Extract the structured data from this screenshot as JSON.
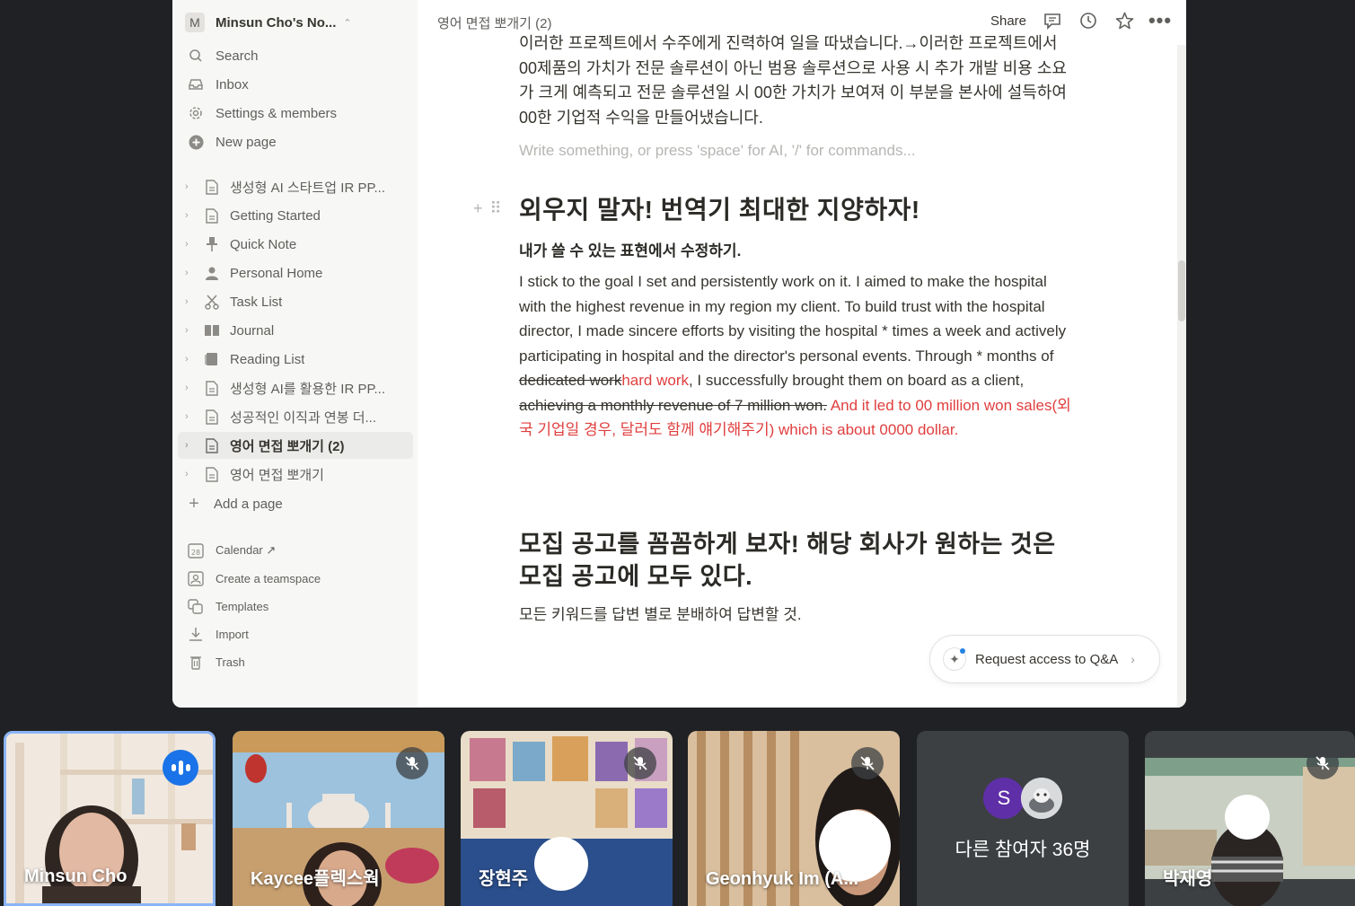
{
  "sidebar": {
    "workspace_initial": "M",
    "workspace_name": "Minsun Cho's No...",
    "nav": [
      {
        "label": "Search",
        "icon": "search-icon"
      },
      {
        "label": "Inbox",
        "icon": "inbox-icon"
      },
      {
        "label": "Settings & members",
        "icon": "gear-icon"
      },
      {
        "label": "New page",
        "icon": "plus-circle-icon"
      }
    ],
    "pages": [
      {
        "label": "생성형 AI 스타트업 IR PP...",
        "icon": "page-icon"
      },
      {
        "label": "Getting Started",
        "icon": "page-icon"
      },
      {
        "label": "Quick Note",
        "icon": "pin-icon"
      },
      {
        "label": "Personal Home",
        "icon": "person-icon"
      },
      {
        "label": "Task List",
        "icon": "scissors-icon"
      },
      {
        "label": "Journal",
        "icon": "book-icon"
      },
      {
        "label": "Reading List",
        "icon": "list-icon"
      },
      {
        "label": "생성형 AI를 활용한 IR PP...",
        "icon": "page-icon"
      },
      {
        "label": "성공적인 이직과 연봉 더...",
        "icon": "page-icon"
      },
      {
        "label": "영어 면접 뽀개기 (2)",
        "icon": "page-icon",
        "active": true
      },
      {
        "label": "영어 면접 뽀개기",
        "icon": "page-icon"
      }
    ],
    "add_page": "Add a page",
    "bottom": [
      {
        "label": "Calendar ↗",
        "icon": "calendar-icon"
      },
      {
        "label": "Create a teamspace",
        "icon": "teamspace-icon"
      },
      {
        "label": "Templates",
        "icon": "templates-icon"
      },
      {
        "label": "Import",
        "icon": "import-icon"
      },
      {
        "label": "Trash",
        "icon": "trash-icon"
      }
    ],
    "calendar_day": "28"
  },
  "topbar": {
    "breadcrumb": "영어 면접 뽀개기 (2)",
    "share": "Share"
  },
  "page": {
    "prev_paragraph": "이러한 프로젝트에서 수주에게 진력하여 일을 따냈습니다.→이러한 프로젝트에서 00제품의 가치가 전문 솔루션이 아닌 범용 솔루션으로 사용 시 추가 개발 비용 소요가 크게 예측되고 전문 솔루션일 시 00한 가치가 보여져 이 부분을 본사에 설득하여 00한 기업적 수익을 만들어냈습니다.",
    "placeholder": "Write something, or press 'space' for AI, '/' for commands...",
    "heading1": "외우지 말자! 번역기 최대한 지양하자!",
    "heading3": "내가 쓸 수 있는 표현에서 수정하기.",
    "para_a": "I stick to the goal I set and persistently work on it. I aimed to make the hospital with the highest revenue in my region my client. To build trust with the hospital director, I made sincere efforts by visiting the hospital * times a week and actively participating in hospital and the director's personal events. Through * months of ",
    "para_strike1": "dedicated work",
    "para_red1": "hard work",
    "para_b": ", I successfully brought them on board as a client, ",
    "para_strike2": "achieving a monthly revenue of 7 million won.",
    "para_red2": " And it led to 00 million won sales(외국 기업일 경우, 달러도 함께 얘기해주기) which is about 0000 dollar.",
    "heading2": "모집 공고를 꼼꼼하게 보자! 해당 회사가 원하는 것은 모집 공고에 모두 있다.",
    "para2": "모든 키워드를 답변 별로 분배하여 답변할 것.",
    "qa_button": "Request access to Q&A"
  },
  "meet": {
    "tiles": [
      {
        "name": "Minsun Cho",
        "state": "speaking"
      },
      {
        "name": "Kaycee플렉스웍",
        "state": "muted"
      },
      {
        "name": "장현주",
        "state": "muted"
      },
      {
        "name": "Geonhyuk Im (A...",
        "state": "muted"
      },
      {
        "name": "박재영",
        "state": "muted"
      }
    ],
    "others_initial": "S",
    "others_label": "다른 참여자 36명"
  }
}
